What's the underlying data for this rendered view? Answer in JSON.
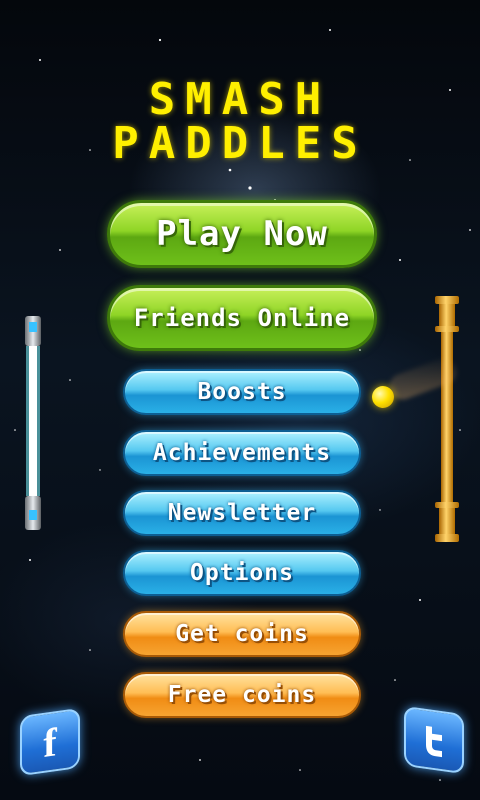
{
  "title": {
    "line1": "SMASH",
    "line2": "PADDLES"
  },
  "menu": {
    "play_now": "Play Now",
    "friends_online": "Friends Online",
    "boosts": "Boosts",
    "achievements": "Achievements",
    "newsletter": "Newsletter",
    "options": "Options",
    "get_coins": "Get coins",
    "free_coins": "Free coins"
  },
  "social": {
    "facebook_icon": "f",
    "twitter_icon": "t"
  },
  "colors": {
    "title": "#ffef00",
    "primary_button": "#8fd526",
    "secondary_button": "#2ab0e6",
    "coin_button": "#f7a431",
    "left_paddle_glow": "#7ff8ff",
    "right_paddle": "#f0a010",
    "ball": "#ffe100"
  }
}
